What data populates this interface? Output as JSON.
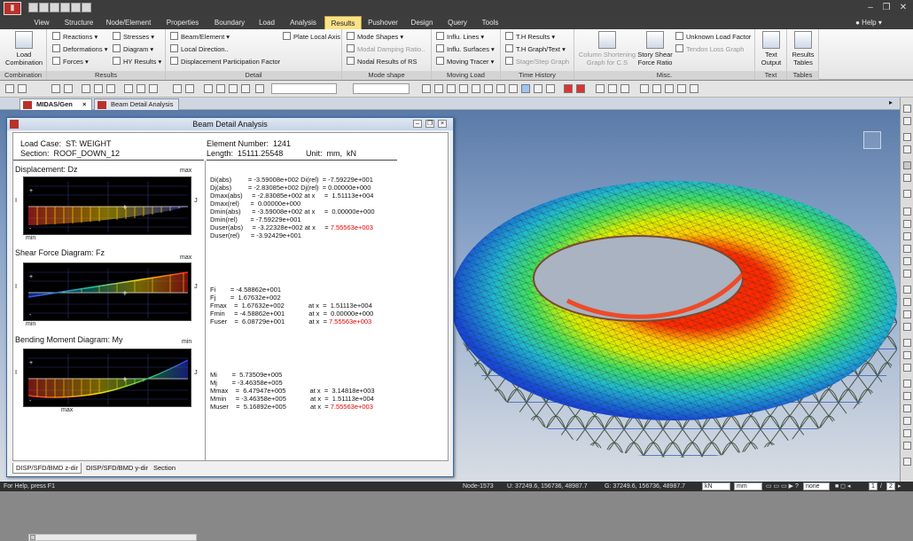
{
  "colors": {
    "accent_tab": "#fbe28a",
    "menubar": "#3d3d3d",
    "shear_line": "#ff2020",
    "red_value": "#e00000"
  },
  "menu": [
    "View",
    "Structure",
    "Node/Element",
    "Properties",
    "Boundary",
    "Load",
    "Analysis",
    "Results",
    "Pushover",
    "Design",
    "Query",
    "Tools"
  ],
  "help": "Help",
  "ribbon": {
    "load_combination": "Load\nCombination",
    "reactions": "Reactions",
    "deformations": "Deformations",
    "forces": "Forces",
    "stresses": "Stresses",
    "diagram": "Diagram",
    "hy_results": "HY Results",
    "beam_element": "Beam/Element",
    "local_direction": "Local Direction..",
    "displacement_pf": "Displacement Participation Factor",
    "plate_local_axis": "Plate Local Axis",
    "mode_shapes": "Mode Shapes",
    "modal_damping": "Modal Damping Ratio..",
    "nodal_results_rs": "Nodal Results of RS",
    "influ_lines": "Influ. Lines",
    "influ_surfaces": "Influ. Surfaces",
    "moving_tracer": "Moving Tracer",
    "th_results": "T.H Results",
    "th_graph": "T.H Graph/Text",
    "stage_step": "Stage/Step Graph",
    "column_shortening": "Column Shortening\nGraph for C.S",
    "story_shear": "Story Shear\nForce Ratio",
    "unknown_load_factor": "Unknown Load Factor",
    "tendon_loss": "Tendon Loss Graph",
    "text_output": "Text\nOutput",
    "results_tables": "Results\nTables",
    "groups": {
      "combination": "Combination",
      "results": "Results",
      "detail": "Detail",
      "mode_shape": "Mode shape",
      "moving_load": "Moving Load",
      "time_history": "Time History",
      "misc": "Misc.",
      "text": "Text",
      "tables": "Tables"
    }
  },
  "tabs": {
    "main": "MIDAS/Gen",
    "detail": "Beam Detail Analysis"
  },
  "panel": {
    "title": "Beam Detail Analysis",
    "load_case": "Load Case:  ST: WEIGHT",
    "section": "Section:  ROOF_DOWN_12",
    "element": "Element Number:  1241",
    "length": "Length:  15111.25548",
    "unit": "Unit:  mm,  kN",
    "disp_title": "Displacement: Dz",
    "shear_title": "Shear Force Diagram: Fz",
    "moment_title": "Bending Moment Diagram: My",
    "lbl_max": "max",
    "lbl_min": "min",
    "lbl_i": "I",
    "lbl_j": "J",
    "disp_block": "Di(abs)         = -3.59008e+002 Di(rel)  = -7.59229e+001\nDj(abs)         = -2.83085e+002 Dj(rel)  = 0.00000e+000\nDmax(abs)     = -2.83085e+002 at x     =  1.51113e+004\nDmax(rel)      =  0.00000e+000\nDmin(abs)      = -3.59008e+002 at x     =  0.00000e+000\nDmin(rel)       = -7.59229e+001",
    "disp_user_a": "Duser(abs)     = -3.22328e+002 at x     = ",
    "disp_user_b": "7.55563e+003",
    "disp_user_rel": "Duser(rel)      = -3.92429e+001",
    "shear_block": "Fi        = -4.58862e+001\nFj        =  1.67632e+002\nFmax    =  1.67632e+002             at x  =  1.51113e+004\nFmin     = -4.58862e+001             at x  =  0.00000e+000",
    "shear_user_a": "Fuser    =  6.08729e+001             at x  = ",
    "shear_user_b": "7.55563e+003",
    "moment_block": "Mi        =  5.73509e+005\nMj        = -3.46358e+005\nMmax    =  6.47947e+005             at x  =  3.14818e+003\nMmin     = -3.46358e+005             at x  =  1.51113e+004",
    "moment_user_a": "Muser    =  5.16892e+005             at x  = ",
    "moment_user_b": "7.55563e+003",
    "bottom_tabs": [
      "DISP/SFD/BMD z-dir",
      "DISP/SFD/BMD y-dir",
      "Section"
    ]
  },
  "status": {
    "help": "For Help, press F1",
    "node": "Node-1573",
    "u": "U: 37249.6, 156736, 48987.7",
    "g": "G: 37249.6, 156736, 48987.7",
    "force_unit": "kN",
    "length_unit": "mm",
    "none": "none",
    "page_cur": "1",
    "page_sep": "/",
    "page_total": "2"
  },
  "icons": [
    "app-logo-icon",
    "new-icon",
    "open-icon",
    "save-icon",
    "print-icon",
    "undo-icon",
    "redo-icon",
    "view-cube-icon"
  ]
}
